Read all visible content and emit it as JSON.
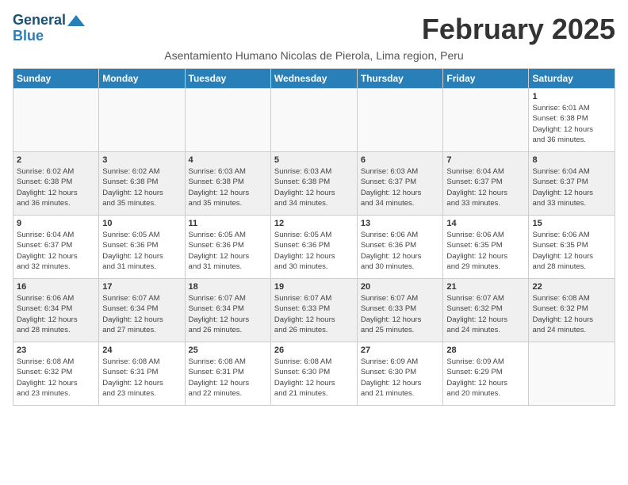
{
  "header": {
    "logo_general": "General",
    "logo_blue": "Blue",
    "month_title": "February 2025",
    "subtitle": "Asentamiento Humano Nicolas de Pierola, Lima region, Peru"
  },
  "days_of_week": [
    "Sunday",
    "Monday",
    "Tuesday",
    "Wednesday",
    "Thursday",
    "Friday",
    "Saturday"
  ],
  "weeks": [
    [
      {
        "day": "",
        "info": ""
      },
      {
        "day": "",
        "info": ""
      },
      {
        "day": "",
        "info": ""
      },
      {
        "day": "",
        "info": ""
      },
      {
        "day": "",
        "info": ""
      },
      {
        "day": "",
        "info": ""
      },
      {
        "day": "1",
        "info": "Sunrise: 6:01 AM\nSunset: 6:38 PM\nDaylight: 12 hours\nand 36 minutes."
      }
    ],
    [
      {
        "day": "2",
        "info": "Sunrise: 6:02 AM\nSunset: 6:38 PM\nDaylight: 12 hours\nand 36 minutes."
      },
      {
        "day": "3",
        "info": "Sunrise: 6:02 AM\nSunset: 6:38 PM\nDaylight: 12 hours\nand 35 minutes."
      },
      {
        "day": "4",
        "info": "Sunrise: 6:03 AM\nSunset: 6:38 PM\nDaylight: 12 hours\nand 35 minutes."
      },
      {
        "day": "5",
        "info": "Sunrise: 6:03 AM\nSunset: 6:38 PM\nDaylight: 12 hours\nand 34 minutes."
      },
      {
        "day": "6",
        "info": "Sunrise: 6:03 AM\nSunset: 6:37 PM\nDaylight: 12 hours\nand 34 minutes."
      },
      {
        "day": "7",
        "info": "Sunrise: 6:04 AM\nSunset: 6:37 PM\nDaylight: 12 hours\nand 33 minutes."
      },
      {
        "day": "8",
        "info": "Sunrise: 6:04 AM\nSunset: 6:37 PM\nDaylight: 12 hours\nand 33 minutes."
      }
    ],
    [
      {
        "day": "9",
        "info": "Sunrise: 6:04 AM\nSunset: 6:37 PM\nDaylight: 12 hours\nand 32 minutes."
      },
      {
        "day": "10",
        "info": "Sunrise: 6:05 AM\nSunset: 6:36 PM\nDaylight: 12 hours\nand 31 minutes."
      },
      {
        "day": "11",
        "info": "Sunrise: 6:05 AM\nSunset: 6:36 PM\nDaylight: 12 hours\nand 31 minutes."
      },
      {
        "day": "12",
        "info": "Sunrise: 6:05 AM\nSunset: 6:36 PM\nDaylight: 12 hours\nand 30 minutes."
      },
      {
        "day": "13",
        "info": "Sunrise: 6:06 AM\nSunset: 6:36 PM\nDaylight: 12 hours\nand 30 minutes."
      },
      {
        "day": "14",
        "info": "Sunrise: 6:06 AM\nSunset: 6:35 PM\nDaylight: 12 hours\nand 29 minutes."
      },
      {
        "day": "15",
        "info": "Sunrise: 6:06 AM\nSunset: 6:35 PM\nDaylight: 12 hours\nand 28 minutes."
      }
    ],
    [
      {
        "day": "16",
        "info": "Sunrise: 6:06 AM\nSunset: 6:34 PM\nDaylight: 12 hours\nand 28 minutes."
      },
      {
        "day": "17",
        "info": "Sunrise: 6:07 AM\nSunset: 6:34 PM\nDaylight: 12 hours\nand 27 minutes."
      },
      {
        "day": "18",
        "info": "Sunrise: 6:07 AM\nSunset: 6:34 PM\nDaylight: 12 hours\nand 26 minutes."
      },
      {
        "day": "19",
        "info": "Sunrise: 6:07 AM\nSunset: 6:33 PM\nDaylight: 12 hours\nand 26 minutes."
      },
      {
        "day": "20",
        "info": "Sunrise: 6:07 AM\nSunset: 6:33 PM\nDaylight: 12 hours\nand 25 minutes."
      },
      {
        "day": "21",
        "info": "Sunrise: 6:07 AM\nSunset: 6:32 PM\nDaylight: 12 hours\nand 24 minutes."
      },
      {
        "day": "22",
        "info": "Sunrise: 6:08 AM\nSunset: 6:32 PM\nDaylight: 12 hours\nand 24 minutes."
      }
    ],
    [
      {
        "day": "23",
        "info": "Sunrise: 6:08 AM\nSunset: 6:32 PM\nDaylight: 12 hours\nand 23 minutes."
      },
      {
        "day": "24",
        "info": "Sunrise: 6:08 AM\nSunset: 6:31 PM\nDaylight: 12 hours\nand 23 minutes."
      },
      {
        "day": "25",
        "info": "Sunrise: 6:08 AM\nSunset: 6:31 PM\nDaylight: 12 hours\nand 22 minutes."
      },
      {
        "day": "26",
        "info": "Sunrise: 6:08 AM\nSunset: 6:30 PM\nDaylight: 12 hours\nand 21 minutes."
      },
      {
        "day": "27",
        "info": "Sunrise: 6:09 AM\nSunset: 6:30 PM\nDaylight: 12 hours\nand 21 minutes."
      },
      {
        "day": "28",
        "info": "Sunrise: 6:09 AM\nSunset: 6:29 PM\nDaylight: 12 hours\nand 20 minutes."
      },
      {
        "day": "",
        "info": ""
      }
    ]
  ]
}
